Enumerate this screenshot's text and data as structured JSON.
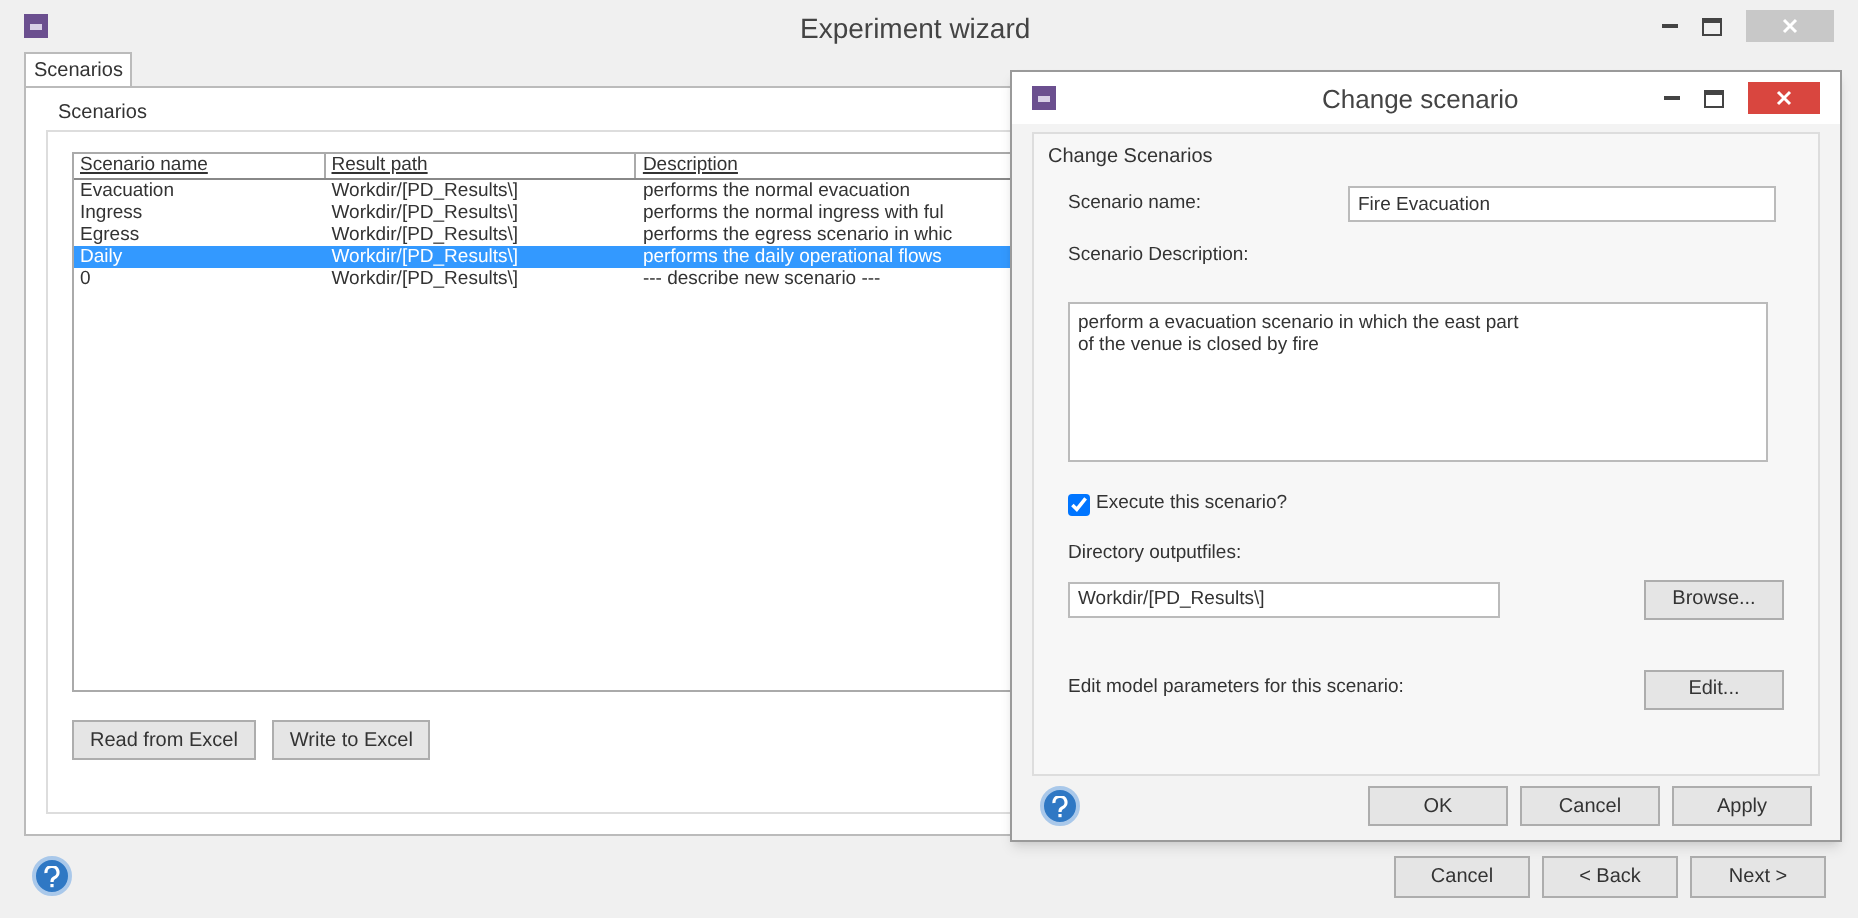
{
  "window": {
    "title": "Experiment wizard"
  },
  "tabs": [
    {
      "label": "Scenarios",
      "selected": true
    }
  ],
  "group_title": "Scenarios",
  "table": {
    "columns": [
      "Scenario name",
      "Result path",
      "Description"
    ],
    "rows": [
      {
        "cells": [
          "Evacuation",
          "Workdir/[PD_Results\\]",
          "performs the normal evacuation"
        ],
        "selected": false
      },
      {
        "cells": [
          "Ingress",
          "Workdir/[PD_Results\\]",
          "performs the normal ingress with ful"
        ],
        "selected": false
      },
      {
        "cells": [
          "Egress",
          "Workdir/[PD_Results\\]",
          "performs the egress scenario in whic"
        ],
        "selected": false
      },
      {
        "cells": [
          "Daily",
          "Workdir/[PD_Results\\]",
          "performs the daily operational flows"
        ],
        "selected": true
      },
      {
        "cells": [
          "0",
          "Workdir/[PD_Results\\]",
          "--- describe new scenario ---"
        ],
        "selected": false
      }
    ]
  },
  "table_buttons": [
    "Read from Excel",
    "Write to Excel"
  ],
  "footer_buttons": [
    "Cancel",
    "< Back",
    "Next >"
  ],
  "dialog": {
    "title": "Change scenario",
    "group_title": "Change Scenarios",
    "name_label": "Scenario name:",
    "name_value": "Fire Evacuation",
    "description_label": "Scenario Description:",
    "description_value": "perform a evacuation scenario in which the east part\nof the venue is closed by fire",
    "execute": {
      "label": "Execute this scenario?",
      "checked": true
    },
    "directory_label": "Directory outputfiles:",
    "directory_value": "Workdir/[PD_Results\\]",
    "browse_button": "Browse...",
    "edit_label": "Edit model parameters for this scenario:",
    "edit_button": "Edit...",
    "buttons": [
      "OK",
      "Cancel",
      "Apply"
    ]
  }
}
